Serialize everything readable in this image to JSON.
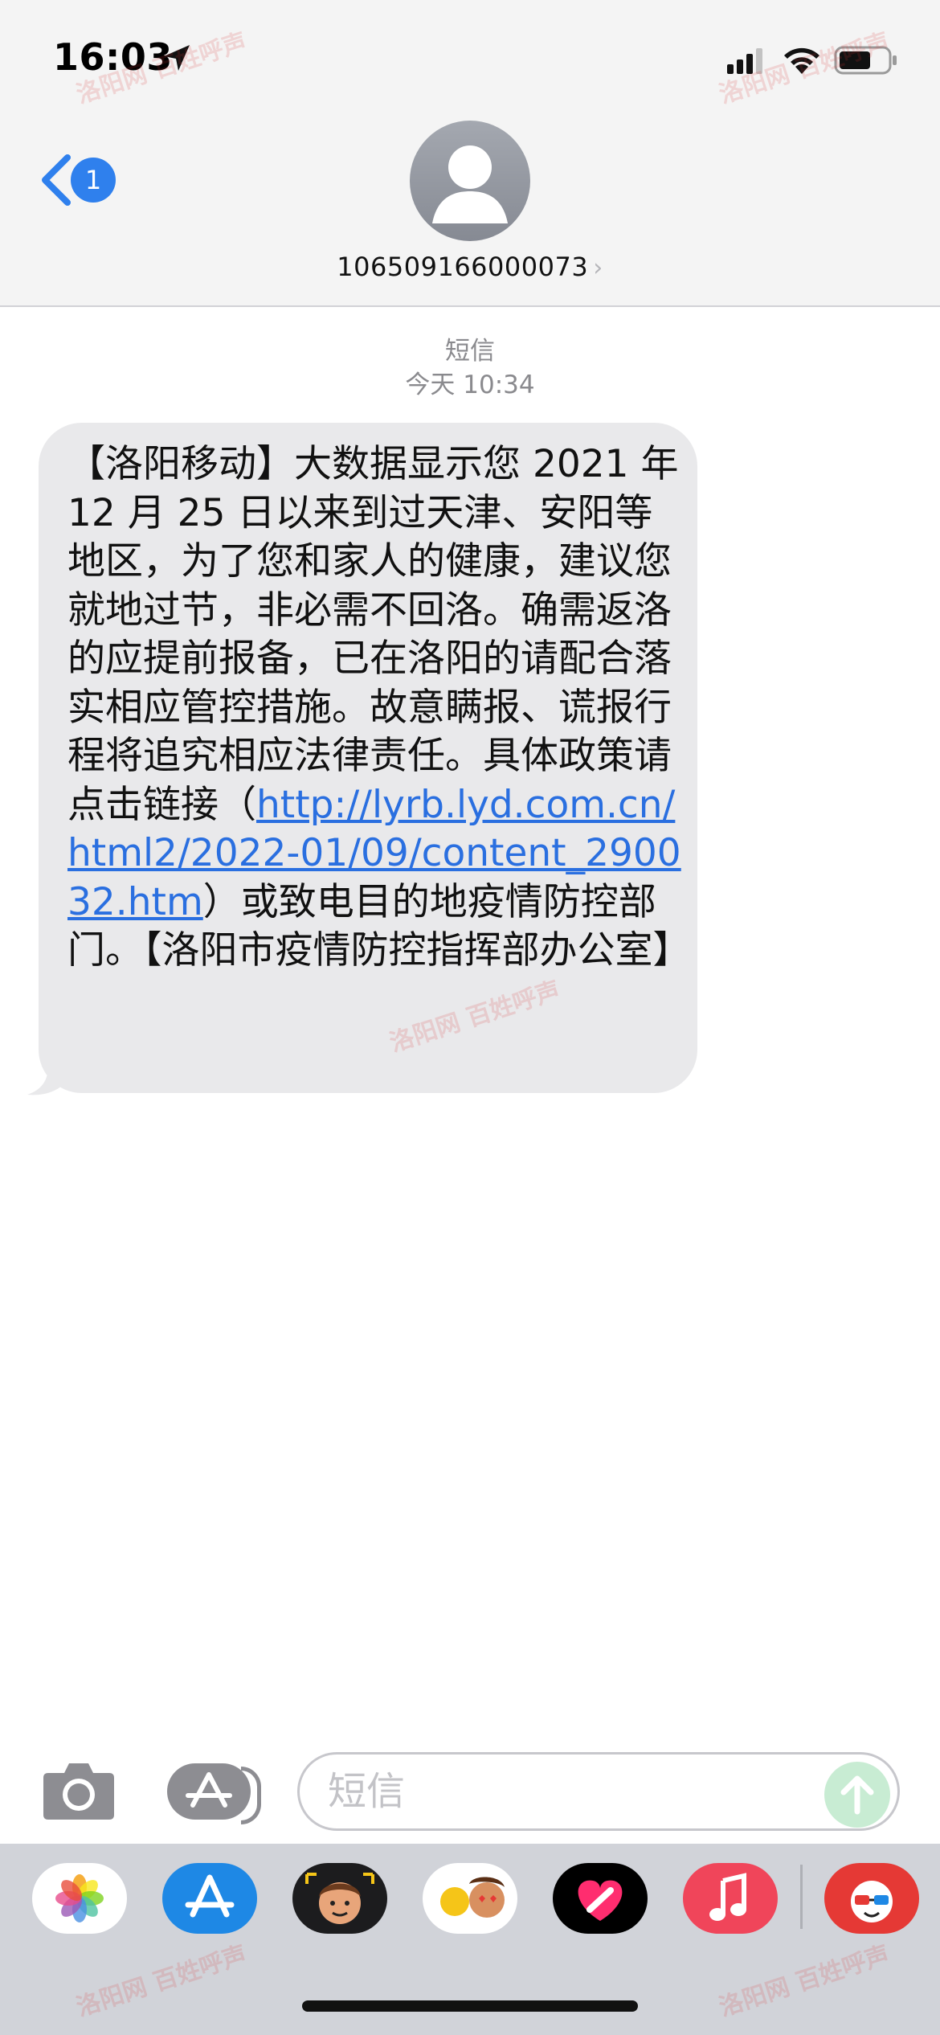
{
  "status_bar": {
    "time": "16:03"
  },
  "header": {
    "back_badge": "1",
    "contact_name": "106509166000073",
    "contact_chevron": "›"
  },
  "conversation": {
    "service_label": "短信",
    "timestamp": "今天 10:34",
    "message": {
      "text_before": "【洛阳移动】大数据显示您 2021 年 12 月 25 日以来到过天津、安阳等地区，为了您和家人的健康，建议您就地过节，非必需不回洛。确需返洛的应提前报备，已在洛阳的请配合落实相应管控措施。故意瞒报、谎报行程将追究相应法律责任。具体政策请点击链接（",
      "link": "http://lyrb.lyd.com.cn/html2/2022-01/09/content_290032.htm",
      "text_after": "）或致电目的地疫情防控部门。【洛阳市疫情防控指挥部办公室】"
    }
  },
  "composer": {
    "placeholder": "短信"
  },
  "app_drawer": {
    "apps": [
      "photos-icon",
      "app-store-icon",
      "memoji-icon",
      "animoji-icon",
      "digital-touch-icon",
      "music-icon",
      "third-party-app-icon"
    ]
  },
  "watermark": "洛阳网 百姓呼声",
  "colors": {
    "accent": "#2f80ed",
    "link": "#2a6fe0",
    "bubble": "#e9e9eb",
    "send_button": "#c8ecd3"
  }
}
